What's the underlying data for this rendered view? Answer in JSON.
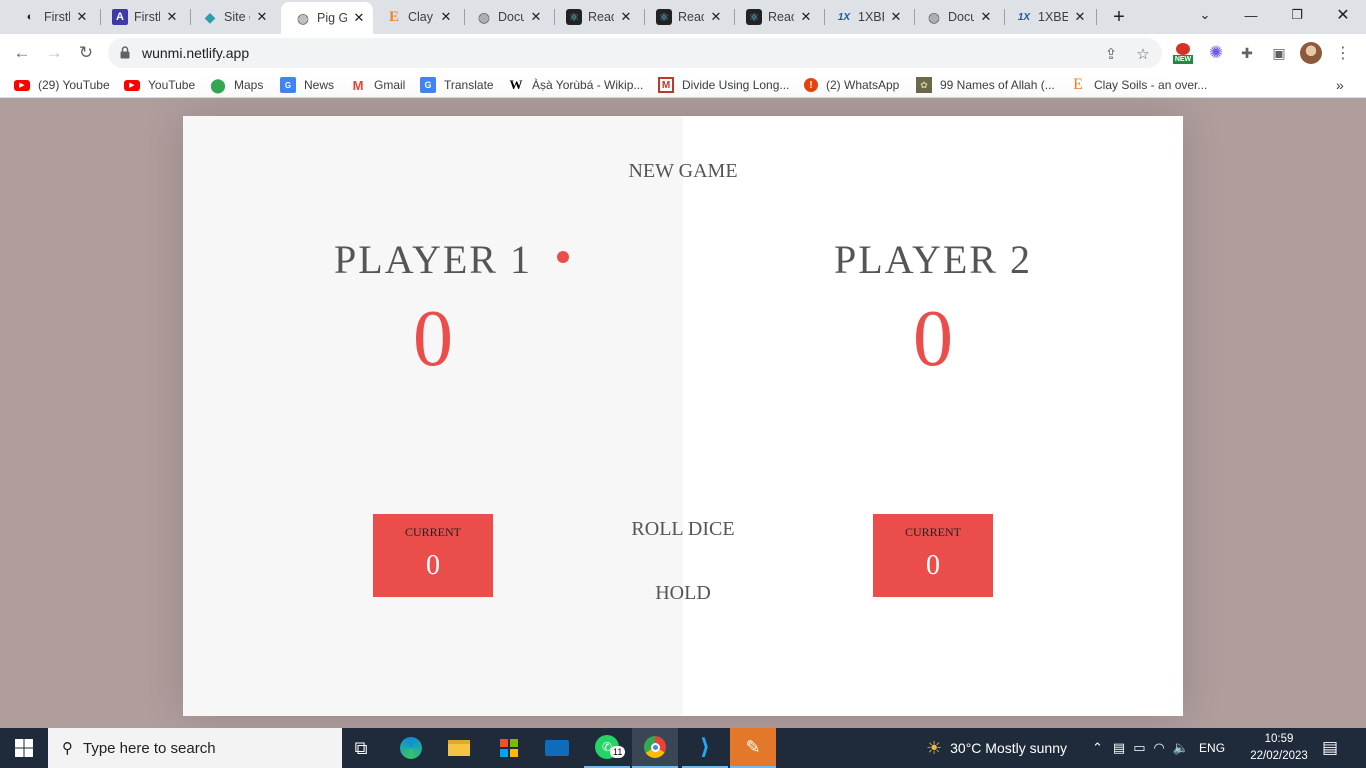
{
  "browser": {
    "tabs": [
      {
        "title": "Firstb",
        "icon": "firstbank-icon",
        "color": "#202124",
        "glyph": "◐"
      },
      {
        "title": "Firstb",
        "icon": "a-icon",
        "color": "#3f3aa8",
        "glyph": "A"
      },
      {
        "title": "Site c",
        "icon": "netlify-icon",
        "color": "#2ba0a8",
        "glyph": "◆"
      },
      {
        "title": "Pig G",
        "icon": "globe-icon",
        "color": "#5f6368",
        "glyph": "◍",
        "active": true
      },
      {
        "title": "Clay",
        "icon": "e-icon",
        "color": "#f0832c",
        "glyph": "E"
      },
      {
        "title": "Docu",
        "icon": "globe-icon",
        "color": "#5f6368",
        "glyph": "◍"
      },
      {
        "title": "React",
        "icon": "react-icon",
        "color": "#61dafb",
        "glyph": "⚛"
      },
      {
        "title": "React",
        "icon": "react-icon",
        "color": "#61dafb",
        "glyph": "⚛"
      },
      {
        "title": "Reac",
        "icon": "react-icon",
        "color": "#61dafb",
        "glyph": "⚛"
      },
      {
        "title": "1XBE",
        "icon": "1x-icon",
        "color": "#1a5aa6",
        "glyph": "1X"
      },
      {
        "title": "Docu",
        "icon": "globe-icon",
        "color": "#5f6368",
        "glyph": "◍"
      },
      {
        "title": "1XBE",
        "icon": "1x-icon",
        "color": "#1a5aa6",
        "glyph": "1X"
      }
    ],
    "url": "wunmi.netlify.app",
    "new_badge": "NEW",
    "bookmarks": [
      {
        "label": "(29) YouTube",
        "icon": "youtube-icon",
        "color": "#ff0000"
      },
      {
        "label": "YouTube",
        "icon": "youtube-icon",
        "color": "#ff0000"
      },
      {
        "label": "Maps",
        "icon": "maps-icon",
        "color": "#34a853"
      },
      {
        "label": "News",
        "icon": "news-icon",
        "color": "#4285f4"
      },
      {
        "label": "Gmail",
        "icon": "gmail-icon",
        "color": "#ea4335"
      },
      {
        "label": "Translate",
        "icon": "translate-icon",
        "color": "#4285f4"
      },
      {
        "label": "Àṣà Yorùbá - Wikip...",
        "icon": "wikipedia-icon",
        "color": "#000000"
      },
      {
        "label": "Divide Using Long...",
        "icon": "m-icon",
        "color": "#c0392b"
      },
      {
        "label": "(2) WhatsApp",
        "icon": "alert-icon",
        "color": "#e8430c"
      },
      {
        "label": "99 Names of Allah (...",
        "icon": "pattern-icon",
        "color": "#6b6b4a"
      },
      {
        "label": "Clay Soils - an over...",
        "icon": "e-icon",
        "color": "#f0832c"
      }
    ]
  },
  "game": {
    "new_game": "NEW GAME",
    "roll_dice": "ROLL DICE",
    "hold": "HOLD",
    "players": [
      {
        "name": "PLAYER 1",
        "score": "0",
        "current_label": "CURRENT",
        "current": "0",
        "active": true
      },
      {
        "name": "PLAYER 2",
        "score": "0",
        "current_label": "CURRENT",
        "current": "0",
        "active": false
      }
    ],
    "accent_color": "#eb4d4b"
  },
  "taskbar": {
    "search_placeholder": "Type here to search",
    "weather": "30°C  Mostly sunny",
    "language": "ENG",
    "time": "10:59",
    "date": "22/02/2023",
    "whatsapp_badge": "11"
  }
}
